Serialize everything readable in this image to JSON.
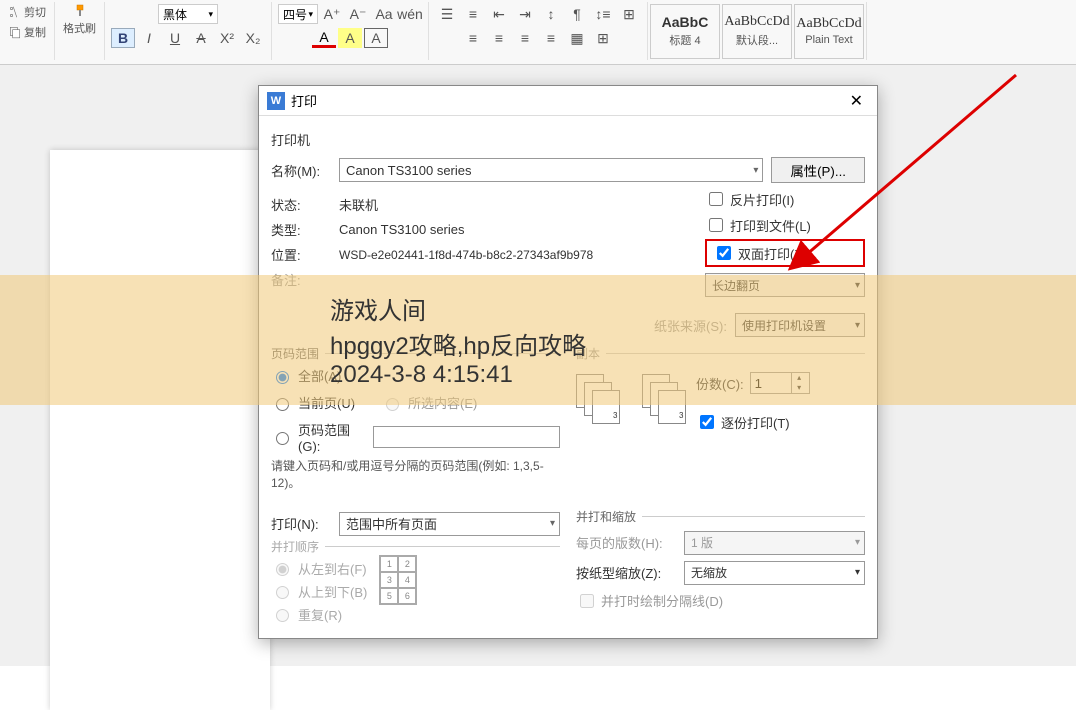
{
  "ribbon": {
    "cut": "剪切",
    "copy": "复制",
    "brush": "格式刷",
    "font_name": "黑体",
    "font_size": "四号",
    "style1_preview": "AaBbC",
    "style1_label": "标题 4",
    "style2_preview": "AaBbCcDd",
    "style2_label": "默认段...",
    "style3_preview": "AaBbCcDd",
    "style3_label": "Plain Text"
  },
  "banner": {
    "l1": "游戏人间",
    "l2": "hpggy2攻略,hp反向攻略",
    "l3": "2024-3-8 4:15:41"
  },
  "dialog": {
    "title": "打印",
    "printer_section": "打印机",
    "name_lbl": "名称(M):",
    "name_val": "Canon TS3100 series",
    "props_btn": "属性(P)...",
    "status_lbl": "状态:",
    "status_val": "未联机",
    "type_lbl": "类型:",
    "type_val": "Canon TS3100 series",
    "loc_lbl": "位置:",
    "loc_val": "WSD-e2e02441-1f8d-474b-b8c2-27343af9b978",
    "note_lbl": "备注:",
    "mirror": "反片打印(I)",
    "to_file": "打印到文件(L)",
    "duplex": "双面打印(X)",
    "duplex_mode": "长边翻页",
    "source_lbl": "纸张来源(S):",
    "source_val": "使用打印机设置",
    "range_section": "页码范围",
    "all": "全部(A)",
    "current": "当前页(U)",
    "selection": "所选内容(E)",
    "pages": "页码范围(G):",
    "hint": "请键入页码和/或用逗号分隔的页码范围(例如: 1,3,5-12)。",
    "copies_section": "副本",
    "copies_lbl": "份数(C):",
    "copies_val": "1",
    "collate": "逐份打印(T)",
    "print_lbl": "打印(N):",
    "print_val": "范围中所有页面",
    "scale_section": "并打和缩放",
    "perpage_lbl": "每页的版数(H):",
    "perpage_val": "1 版",
    "scale_lbl": "按纸型缩放(Z):",
    "scale_val": "无缩放",
    "sep_line": "并打时绘制分隔线(D)",
    "order_section": "并打顺序",
    "lr": "从左到右(F)",
    "tb": "从上到下(B)",
    "rep": "重复(R)"
  }
}
